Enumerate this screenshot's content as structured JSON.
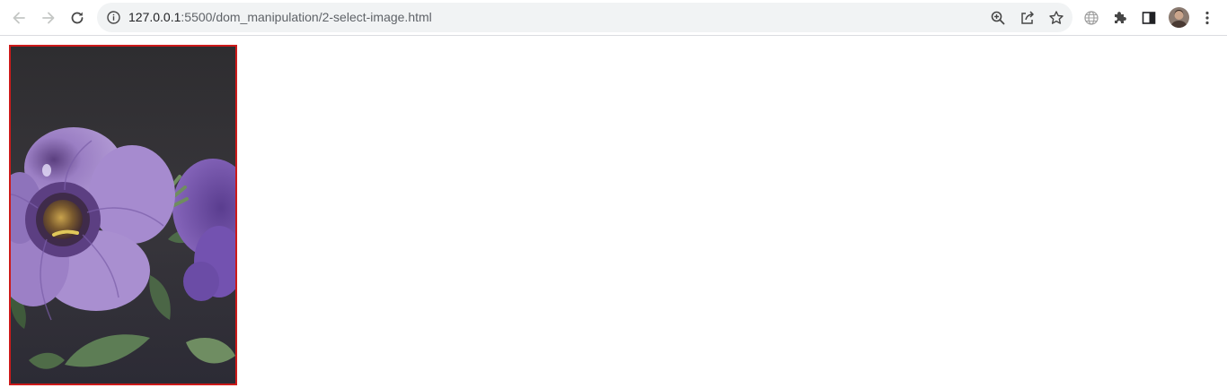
{
  "browser": {
    "url_host": "127.0.0.1",
    "url_rest": ":5500/dom_manipulation/2-select-image.html",
    "icons": {
      "back": "arrow-left-icon",
      "forward": "arrow-right-icon",
      "reload": "reload-icon",
      "site_info": "info-icon",
      "zoom": "zoom-icon",
      "share": "share-icon",
      "bookmark": "star-icon",
      "translate": "globe-icon",
      "extensions": "puzzle-icon",
      "side_panel": "side-panel-icon",
      "menu": "kebab-menu-icon"
    }
  },
  "page": {
    "image": {
      "subject": "purple petunia flowers",
      "border_color": "#cc1a1a"
    }
  }
}
